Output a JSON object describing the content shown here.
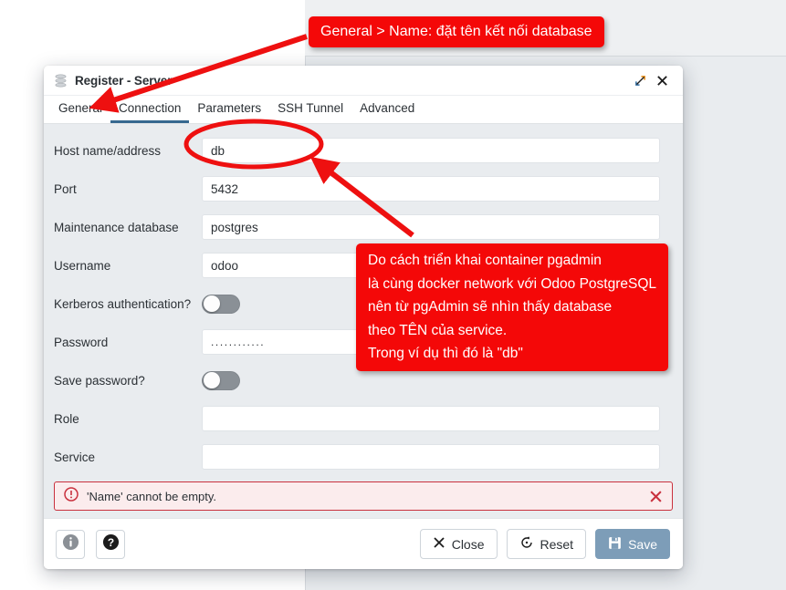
{
  "dialog": {
    "title": "Register - Server",
    "title_icon": "database-server-icon",
    "maximize_icon": "maximize-icon",
    "close_icon": "close-icon",
    "tabs": [
      {
        "label": "General",
        "active": false
      },
      {
        "label": "Connection",
        "active": true
      },
      {
        "label": "Parameters",
        "active": false
      },
      {
        "label": "SSH Tunnel",
        "active": false
      },
      {
        "label": "Advanced",
        "active": false
      }
    ],
    "fields": [
      {
        "label": "Host name/address",
        "value": "db",
        "type": "text"
      },
      {
        "label": "Port",
        "value": "5432",
        "type": "text"
      },
      {
        "label": "Maintenance database",
        "value": "postgres",
        "type": "text"
      },
      {
        "label": "Username",
        "value": "odoo",
        "type": "text"
      },
      {
        "label": "Kerberos authentication?",
        "value": "off",
        "type": "toggle"
      },
      {
        "label": "Password",
        "value": "............",
        "type": "password"
      },
      {
        "label": "Save password?",
        "value": "off",
        "type": "toggle"
      },
      {
        "label": "Role",
        "value": "",
        "type": "text"
      },
      {
        "label": "Service",
        "value": "",
        "type": "text"
      }
    ],
    "error": {
      "icon": "error-circle-icon",
      "message": "'Name' cannot be empty.",
      "dismiss_icon": "close-icon"
    },
    "footer": {
      "info_label": "i",
      "info_icon": "info-icon",
      "help_label": "?",
      "help_icon": "help-icon",
      "close_label": "Close",
      "close_icon": "x-icon",
      "reset_label": "Reset",
      "reset_icon": "reset-icon",
      "save_label": "Save",
      "save_icon": "save-floppy-icon"
    }
  },
  "annotations": {
    "top": "General > Name: đặt tên kết nối database",
    "right": "Do cách triển khai container pgadmin\nlà cùng docker network với Odoo PostgreSQL\nnên từ pgAdmin sẽ nhìn thấy database\ntheo TÊN của service.\nTrong ví dụ thì đó là \"db\""
  },
  "colors": {
    "annotation_red": "#f40808",
    "tab_active_underline": "#36688f",
    "error_border": "#c9313e",
    "error_background": "#fbeced",
    "save_button": "#7d9db8",
    "form_background": "#e9ecef"
  }
}
